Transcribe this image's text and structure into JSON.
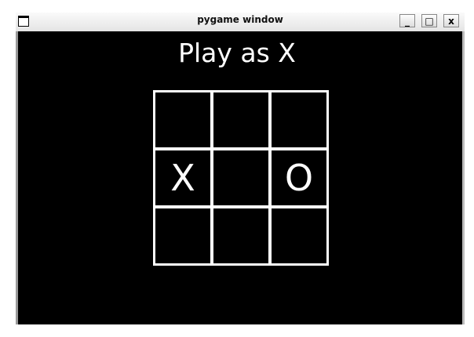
{
  "window": {
    "title": "pygame window",
    "minimize": "_",
    "maximize": "□",
    "close": "x"
  },
  "game": {
    "heading": "Play as X",
    "board": [
      [
        "",
        "",
        ""
      ],
      [
        "X",
        "",
        "O"
      ],
      [
        "",
        "",
        ""
      ]
    ]
  }
}
